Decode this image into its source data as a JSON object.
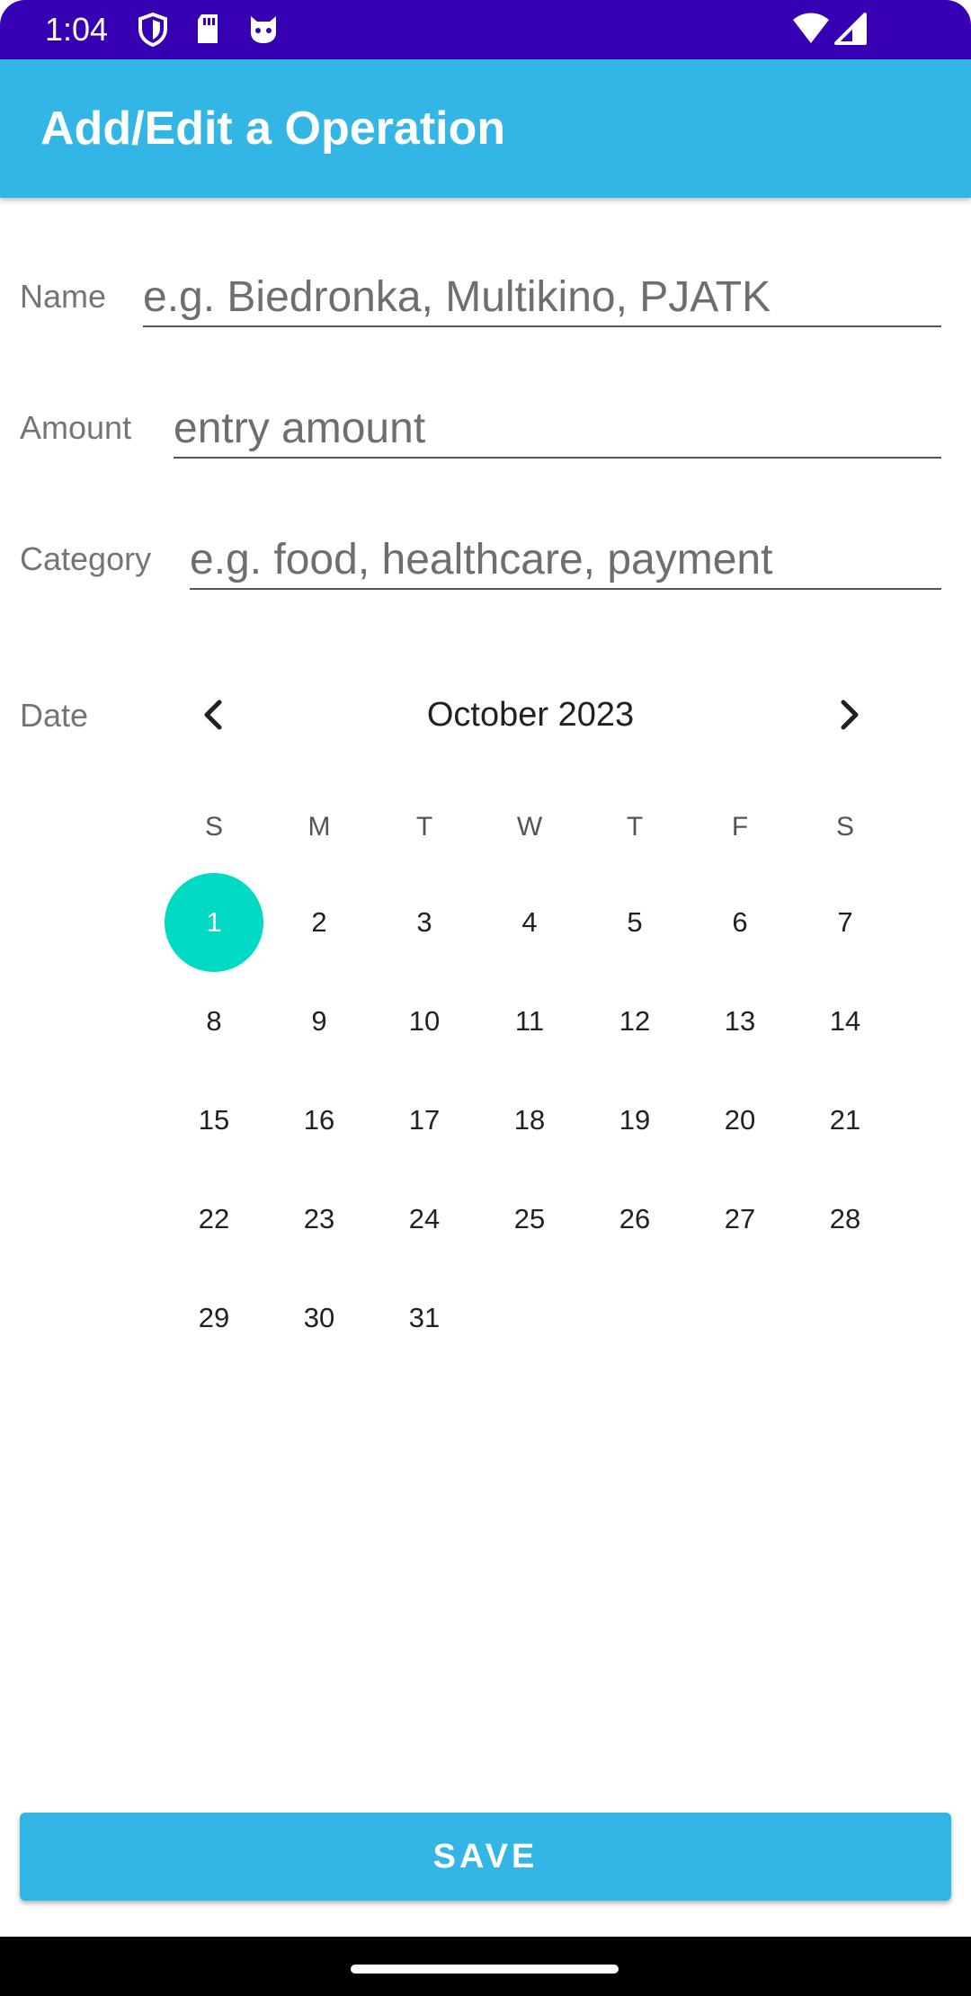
{
  "status_bar": {
    "time": "1:04",
    "icons": [
      "shield-icon",
      "sd-card-icon",
      "cat-icon",
      "wifi-icon",
      "signal-icon"
    ]
  },
  "app_bar": {
    "title": "Add/Edit a Operation"
  },
  "form": {
    "name": {
      "label": "Name",
      "placeholder": "e.g. Biedronka, Multikino, PJATK"
    },
    "amount": {
      "label": "Amount",
      "placeholder": "entry amount"
    },
    "category": {
      "label": "Category",
      "placeholder": "e.g. food, healthcare, payment"
    },
    "date": {
      "label": "Date"
    }
  },
  "calendar": {
    "month_year": "October 2023",
    "weekdays": [
      "S",
      "M",
      "T",
      "W",
      "T",
      "F",
      "S"
    ],
    "selected_day": 1,
    "first_weekday_index": 0,
    "days_in_month": 31,
    "nav_prev_icon": "chevron-left-icon",
    "nav_next_icon": "chevron-right-icon"
  },
  "save_button": {
    "label": "SAVE"
  },
  "colors": {
    "status_bar": "#3700B3",
    "app_bar": "#33B5E5",
    "selected_day": "#00DAC5",
    "save_button": "#33B5E5"
  }
}
